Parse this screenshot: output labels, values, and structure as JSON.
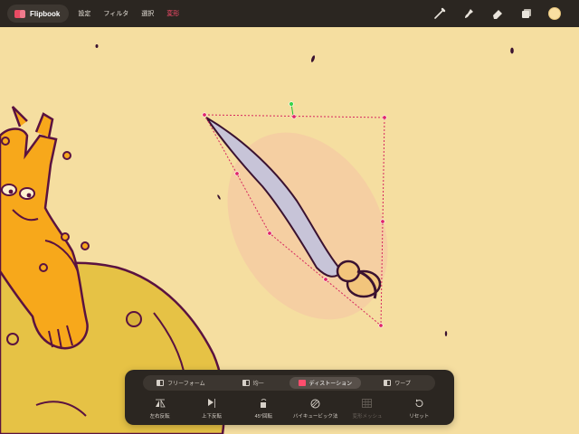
{
  "app": {
    "name": "Flipbook"
  },
  "menu": {
    "items": [
      {
        "label": "設定",
        "active": false
      },
      {
        "label": "フィルタ",
        "active": false
      },
      {
        "label": "選択",
        "active": false
      },
      {
        "label": "変形",
        "active": true
      }
    ]
  },
  "toolbar": {
    "tools": [
      {
        "icon": "brush-icon"
      },
      {
        "icon": "smudge-icon"
      },
      {
        "icon": "eraser-icon"
      },
      {
        "icon": "layers-icon"
      }
    ],
    "current_color": "#f9dfa2"
  },
  "transform_panel": {
    "modes": [
      {
        "label": "フリーフォーム",
        "icon": "freeform-icon",
        "active": false
      },
      {
        "label": "均一",
        "icon": "uniform-icon",
        "active": false
      },
      {
        "label": "ディストーション",
        "icon": "distort-icon",
        "active": true
      },
      {
        "label": "ワープ",
        "icon": "warp-icon",
        "active": false
      }
    ],
    "actions": [
      {
        "label": "左右反転",
        "icon": "flip-horizontal-icon",
        "enabled": true
      },
      {
        "label": "上下反転",
        "icon": "flip-vertical-icon",
        "enabled": true
      },
      {
        "label": "45°回転",
        "icon": "rotate-45-icon",
        "enabled": true
      },
      {
        "label": "バイキュービック法",
        "icon": "bicubic-icon",
        "enabled": true
      },
      {
        "label": "変形メッシュ",
        "icon": "mesh-icon",
        "enabled": false
      },
      {
        "label": "リセット",
        "icon": "reset-icon",
        "enabled": true
      }
    ]
  },
  "colors": {
    "accent": "#ff4d6d",
    "canvas_background": "#f5dea0",
    "character": "#f7a81b",
    "rock": "#e6c245",
    "outline": "#5a1240",
    "brush_body": "#c7c4d8"
  }
}
